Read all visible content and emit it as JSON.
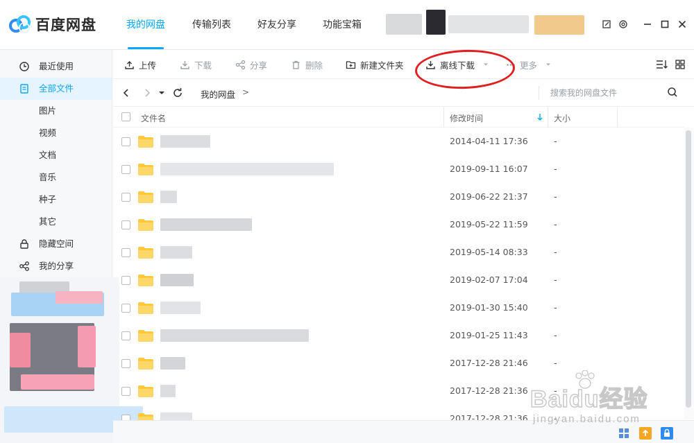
{
  "app": {
    "name": "百度网盘",
    "brand_color": "#06a7ff"
  },
  "nav": {
    "tabs": [
      {
        "label": "我的网盘",
        "active": true
      },
      {
        "label": "传输列表",
        "active": false
      },
      {
        "label": "好友分享",
        "active": false
      },
      {
        "label": "功能宝箱",
        "active": false
      }
    ]
  },
  "header_icons": [
    "pin-icon",
    "settings-icon",
    "minimize-icon",
    "maximize-icon",
    "close-icon"
  ],
  "sidebar": {
    "items": [
      {
        "label": "最近使用",
        "icon": "clock-icon"
      },
      {
        "label": "全部文件",
        "icon": "file-icon",
        "active": true
      },
      {
        "label": "图片"
      },
      {
        "label": "视频"
      },
      {
        "label": "文档"
      },
      {
        "label": "音乐"
      },
      {
        "label": "种子"
      },
      {
        "label": "其它"
      },
      {
        "label": "隐藏空间",
        "icon": "lock-icon"
      },
      {
        "label": "我的分享",
        "icon": "share-icon"
      }
    ]
  },
  "toolbar": {
    "upload": "上传",
    "download": "下载",
    "share": "分享",
    "delete": "删除",
    "new_folder": "新建文件夹",
    "offline_download": "离线下载",
    "more": "更多"
  },
  "pathbar": {
    "crumb": "我的网盘",
    "separator": ">",
    "search_placeholder": "搜索我的网盘文件"
  },
  "list": {
    "columns": {
      "name": "文件名",
      "modified": "修改时间",
      "size": "大小"
    },
    "rows": [
      {
        "date": "2014-04-11 17:36",
        "size": "-"
      },
      {
        "date": "2019-09-11 16:07",
        "size": "-"
      },
      {
        "date": "2019-06-22 21:37",
        "size": "-"
      },
      {
        "date": "2019-05-22 11:59",
        "size": "-"
      },
      {
        "date": "2019-05-14 08:33",
        "size": "-"
      },
      {
        "date": "2019-02-07 17:04",
        "size": "-"
      },
      {
        "date": "2019-01-30 15:40",
        "size": "-"
      },
      {
        "date": "2019-01-25 11:43",
        "size": "-"
      },
      {
        "date": "2017-12-28 21:46",
        "size": "-"
      },
      {
        "date": "2017-12-28 21:36",
        "size": "-"
      },
      {
        "date": "2017-12-28 21:36",
        "size": "-"
      }
    ]
  },
  "watermark": {
    "brand": "Baidu经验",
    "url": "jingyan.baidu.com"
  }
}
